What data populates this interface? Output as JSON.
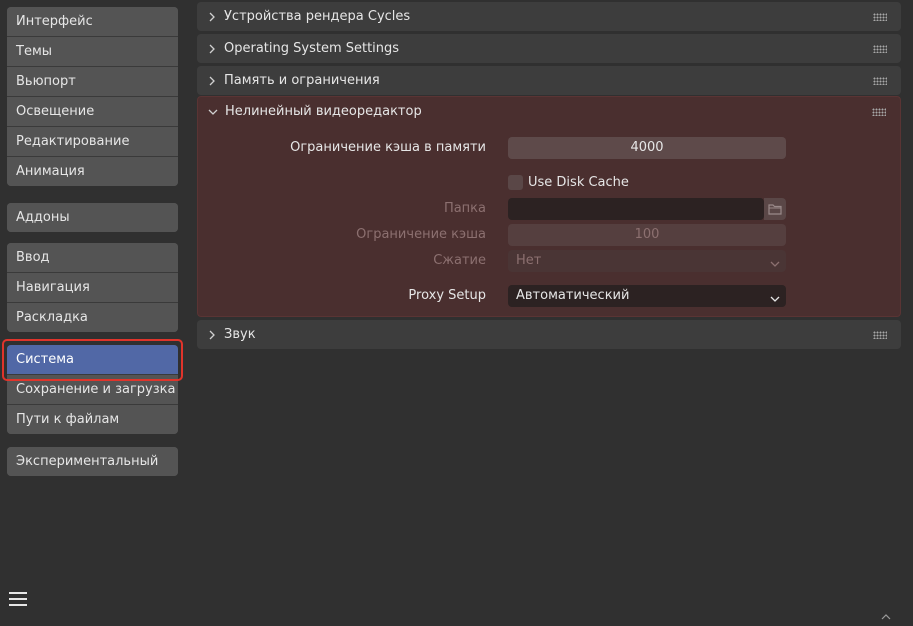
{
  "sidebar": {
    "groups": [
      [
        "Интерфейс",
        "Темы",
        "Вьюпорт",
        "Освещение",
        "Редактирование",
        "Анимация"
      ],
      [
        "Аддоны"
      ],
      [
        "Ввод",
        "Навигация",
        "Раскладка"
      ],
      [
        "Система",
        "Сохранение и загрузка",
        "Пути к файлам"
      ],
      [
        "Экспериментальный"
      ]
    ],
    "active": "Система"
  },
  "panels": {
    "cycles_devices": "Устройства рендера Cycles",
    "os_settings": "Operating System Settings",
    "memory_limits": "Память и ограничения",
    "sequencer": "Нелинейный видеоредактор",
    "sound": "Звук"
  },
  "sequencer": {
    "cache_limit_label": "Ограничение кэша в памяти",
    "cache_limit_value": "4000",
    "use_disk_cache_label": "Use Disk Cache",
    "use_disk_cache_checked": false,
    "folder_label": "Папка",
    "folder_value": "",
    "disk_cache_limit_label": "Ограничение кэша",
    "disk_cache_limit_value": "100",
    "compression_label": "Сжатие",
    "compression_value": "Нет",
    "proxy_setup_label": "Proxy Setup",
    "proxy_setup_value": "Автоматический"
  },
  "colors": {
    "active_item": "#5168a6",
    "highlight_box": "#e0342b",
    "sequencer_panel_bg": "#4a2f2f"
  },
  "icons": {
    "menu": "hamburger-menu-icon",
    "panel_collapsed": "chevron-right-icon",
    "panel_expanded": "chevron-down-icon",
    "drag": "grip-dots-icon",
    "folder": "folder-icon",
    "dropdown": "chevron-down-icon"
  }
}
